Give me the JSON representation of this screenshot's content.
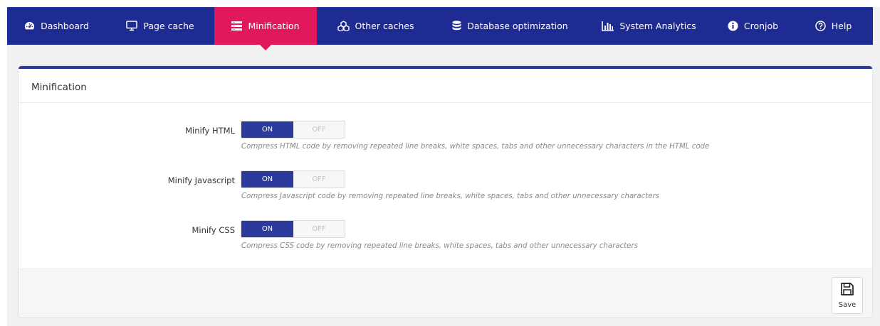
{
  "nav": {
    "tabs": [
      {
        "label": "Dashboard",
        "icon": "dashboard-icon"
      },
      {
        "label": "Page cache",
        "icon": "monitor-icon"
      },
      {
        "label": "Minification",
        "icon": "list-icon",
        "active": true
      },
      {
        "label": "Other caches",
        "icon": "cubes-icon"
      },
      {
        "label": "Database optimization",
        "icon": "database-icon"
      },
      {
        "label": "System Analytics",
        "icon": "bar-chart-icon"
      },
      {
        "label": "Cronjob",
        "icon": "info-icon"
      },
      {
        "label": "Help",
        "icon": "question-icon"
      }
    ]
  },
  "panel": {
    "title": "Minification",
    "settings": [
      {
        "label": "Minify HTML",
        "on": "ON",
        "off": "OFF",
        "value": "ON",
        "description": "Compress HTML code by removing repeated line breaks, white spaces, tabs and other unnecessary characters in the HTML code"
      },
      {
        "label": "Minify Javascript",
        "on": "ON",
        "off": "OFF",
        "value": "ON",
        "description": "Compress Javascript code by removing repeated line breaks, white spaces, tabs and other unnecessary characters"
      },
      {
        "label": "Minify CSS",
        "on": "ON",
        "off": "OFF",
        "value": "ON",
        "description": "Compress CSS code by removing repeated line breaks, white spaces, tabs and other unnecessary characters"
      }
    ],
    "save_label": "Save"
  },
  "colors": {
    "navbar": "#1d2b93",
    "active_tab": "#e0195f",
    "toggle_on": "#2c3a9c"
  }
}
